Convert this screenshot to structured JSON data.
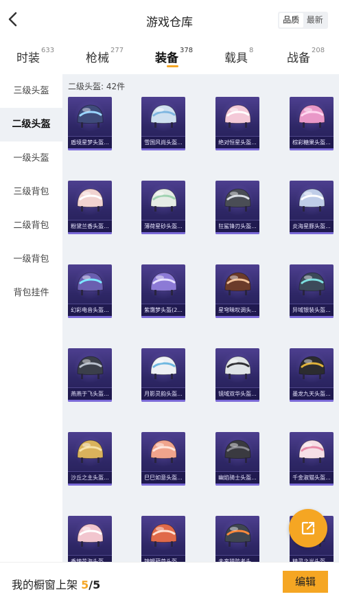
{
  "header": {
    "title": "游戏仓库",
    "sort_options": [
      "品质",
      "最新"
    ],
    "sort_selected": "品质"
  },
  "tabs": [
    {
      "label": "时装",
      "count": "633"
    },
    {
      "label": "枪械",
      "count": "277"
    },
    {
      "label": "装备",
      "count": "378"
    },
    {
      "label": "载具",
      "count": "8"
    },
    {
      "label": "战备",
      "count": "208"
    }
  ],
  "active_tab": "装备",
  "sidebar": {
    "items": [
      {
        "label": "三级头盔"
      },
      {
        "label": "二级头盔"
      },
      {
        "label": "一级头盔"
      },
      {
        "label": "三级背包"
      },
      {
        "label": "二级背包"
      },
      {
        "label": "一级背包"
      },
      {
        "label": "背包挂件"
      }
    ],
    "active": "二级头盔"
  },
  "section": {
    "label": "二级头盔: 42件"
  },
  "items": [
    {
      "name": "盾境星梦头盔...",
      "color": "#3f4b7a",
      "accent": "#9ad6ff"
    },
    {
      "name": "雪国风尚头盔...",
      "color": "#cfe0f0",
      "accent": "#7fb6e0"
    },
    {
      "name": "绝对恒星头盔...",
      "color": "#f4c9d8",
      "accent": "#ffffff"
    },
    {
      "name": "棕彩糖果头盔...",
      "color": "#e998c8",
      "accent": "#ffd6ef"
    },
    {
      "name": "粉黛兰香头盔...",
      "color": "#f1d3d0",
      "accent": "#ffffff"
    },
    {
      "name": "薄荷星砂头盔...",
      "color": "#e6ece6",
      "accent": "#9fd2b0"
    },
    {
      "name": "狂鲨锋刃头盔...",
      "color": "#4a4d55",
      "accent": "#d9dde4"
    },
    {
      "name": "炎海星豚头盔...",
      "color": "#bfcde8",
      "accent": "#ffffff"
    },
    {
      "name": "幻彩电音头盔...",
      "color": "#6a5fb0",
      "accent": "#7de7ff"
    },
    {
      "name": "紫霭梦头盔(2...",
      "color": "#8c7ad6",
      "accent": "#e6e0ff"
    },
    {
      "name": "星穹昧叹调头...",
      "color": "#6b3b2a",
      "accent": "#f2c29a"
    },
    {
      "name": "异域银装头盔...",
      "color": "#3c4a5a",
      "accent": "#7ee0e0"
    },
    {
      "name": "燕燕于飞头盔...",
      "color": "#3b3f4a",
      "accent": "#b9c0cc"
    },
    {
      "name": "月影灵韵头盔...",
      "color": "#eef0f4",
      "accent": "#6fb7e0"
    },
    {
      "name": "镜域双华头盔...",
      "color": "#dfe3e6",
      "accent": "#2f2f33"
    },
    {
      "name": "墨龙九天头盔...",
      "color": "#2c2c30",
      "accent": "#e0b23a"
    },
    {
      "name": "沙丘之主头盔...",
      "color": "#d9b25c",
      "accent": "#f6e2a8"
    },
    {
      "name": "巳巳如意头盔...",
      "color": "#f0a48c",
      "accent": "#ffe6dc"
    },
    {
      "name": "幽焰骑士头盔...",
      "color": "#3a3a40",
      "accent": "#8a8a92"
    },
    {
      "name": "千金淑猫头盔...",
      "color": "#f6dfe6",
      "accent": "#e88aa8"
    },
    {
      "name": "香辣花海头盔...",
      "color": "#f2c6cf",
      "accent": "#ffffff"
    },
    {
      "name": "锦鲤葫芦头盔...",
      "color": "#e06a4a",
      "accent": "#ffe1d2"
    },
    {
      "name": "未来猎防者头...",
      "color": "#3f4650",
      "accent": "#ff8a3c"
    },
    {
      "name": "精灵之光头盔...",
      "color": "#3c3f58",
      "accent": "#c9c2ff"
    }
  ],
  "footer": {
    "label": "我的橱窗上架",
    "current": "5",
    "separator": "/",
    "total": "5",
    "edit_label": "编辑"
  },
  "icons": {
    "back": "chevron-left-icon",
    "share": "external-link-icon"
  },
  "colors": {
    "accent": "#f5a623",
    "card_bg": "#2e2766",
    "content_bg": "#eef1f5"
  }
}
